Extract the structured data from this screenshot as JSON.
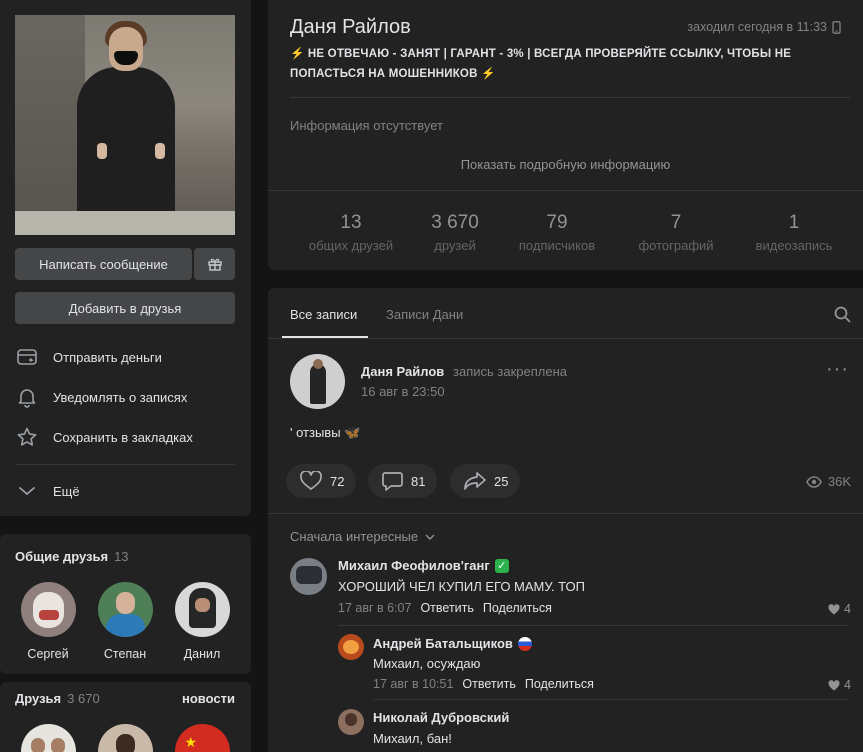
{
  "profile": {
    "name": "Даня Райлов",
    "last_seen": "заходил сегодня в 11:33",
    "status": "⚡️ НЕ ОТВЕЧАЮ - ЗАНЯТ | ГАРАНТ - 3% | ВСЕГДА ПРОВЕРЯЙТЕ ССЫЛКУ, ЧТОБЫ НЕ ПОПАСТЬСЯ НА МОШЕННИКОВ ⚡️",
    "no_info": "Информация отсутствует",
    "show_more": "Показать подробную информацию",
    "counters": [
      {
        "value": "13",
        "label": "общих друзей"
      },
      {
        "value": "3 670",
        "label": "друзей"
      },
      {
        "value": "79",
        "label": "подписчиков"
      },
      {
        "value": "7",
        "label": "фотографий"
      },
      {
        "value": "1",
        "label": "видеозапись"
      }
    ]
  },
  "actions": {
    "message": "Написать сообщение",
    "add_friend": "Добавить в друзья",
    "menu": [
      {
        "label": "Отправить деньги",
        "icon": "money-card-icon"
      },
      {
        "label": "Уведомлять о записях",
        "icon": "bell-icon"
      },
      {
        "label": "Сохранить в закладках",
        "icon": "star-icon"
      }
    ],
    "more": "Ещё"
  },
  "mutual_friends": {
    "title": "Общие друзья",
    "count": "13",
    "items": [
      {
        "name": "Сергей"
      },
      {
        "name": "Степан"
      },
      {
        "name": "Данил"
      }
    ]
  },
  "friends": {
    "title": "Друзья",
    "count": "3 670",
    "link": "новости"
  },
  "wall": {
    "tabs": [
      "Все записи",
      "Записи Дани"
    ],
    "post": {
      "author": "Даня Райлов",
      "pinned": "запись закреплена",
      "date": "16 авг в 23:50",
      "text": "' отзывы 🦋",
      "likes": "72",
      "comments": "81",
      "shares": "25",
      "views": "36K"
    },
    "sort": "Сначала интересные",
    "comments": [
      {
        "author": "Михаил Феофилов'ганг",
        "badge": "✅",
        "text": "ХОРОШИЙ ЧЕЛ КУПИЛ ЕГО МАМУ. ТОП",
        "date": "17 авг в 6:07",
        "reply": "Ответить",
        "share": "Поделиться",
        "likes": "4"
      },
      {
        "author": "Андрей Батальщиков",
        "badge": "🇷🇺",
        "text": "Михаил, осуждаю",
        "date": "17 авг в 10:51",
        "reply": "Ответить",
        "share": "Поделиться",
        "likes": "4"
      },
      {
        "author": "Николай Дубровский",
        "text": "Михаил, бан!"
      }
    ]
  },
  "colors": {
    "background": "#141414",
    "panel": "#222222",
    "button": "#454647",
    "text": "#e1e3e6",
    "muted": "#828282"
  }
}
